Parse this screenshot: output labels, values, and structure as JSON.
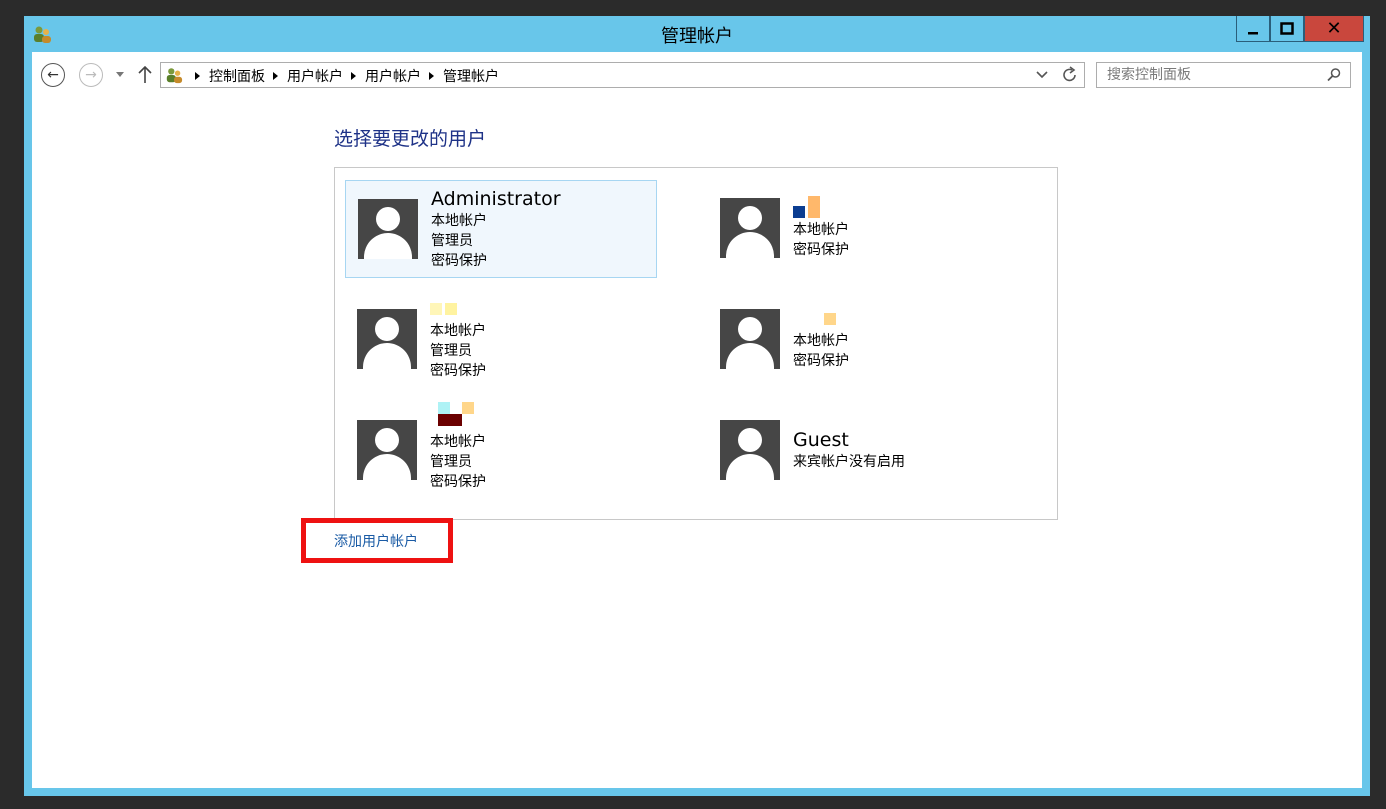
{
  "window": {
    "title": "管理帐户",
    "controls": {
      "minimize": "minimize",
      "maximize": "maximize",
      "close": "✕"
    }
  },
  "nav": {
    "breadcrumbs": [
      "控制面板",
      "用户帐户",
      "用户帐户",
      "管理帐户"
    ],
    "search_placeholder": "搜索控制面板"
  },
  "page": {
    "heading": "选择要更改的用户",
    "users": [
      {
        "name": "Administrator",
        "details": [
          "本地帐户",
          "管理员",
          "密码保护"
        ],
        "selected": true
      },
      {
        "name": "",
        "details": [
          "本地帐户",
          "密码保护"
        ],
        "selected": false
      },
      {
        "name": "",
        "details": [
          "本地帐户",
          "管理员",
          "密码保护"
        ],
        "selected": false
      },
      {
        "name": "",
        "details": [
          "本地帐户",
          "密码保护"
        ],
        "selected": false
      },
      {
        "name": "",
        "details": [
          "本地帐户",
          "管理员",
          "密码保护"
        ],
        "selected": false
      },
      {
        "name": "Guest",
        "details": [
          "来宾帐户没有启用"
        ],
        "selected": false
      }
    ],
    "add_user_link": "添加用户帐户"
  },
  "colors": {
    "titlebar": "#68c6ea",
    "close_button": "#c9473d",
    "heading": "#1e3287",
    "link": "#1a5ba5",
    "highlight_box": "#ee1111",
    "avatar": "#464646"
  }
}
